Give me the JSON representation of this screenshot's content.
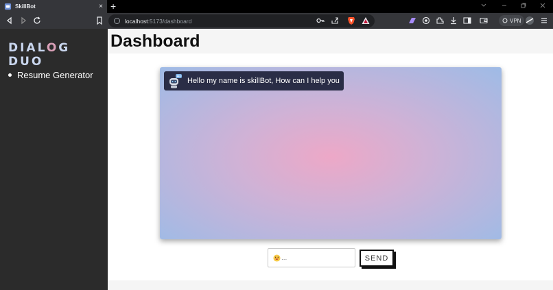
{
  "browser": {
    "tab_title": "SkillBot",
    "tab_close_glyph": "×",
    "new_tab_glyph": "+",
    "url_host": "localhost",
    "url_path": ":5173/dashboard",
    "vpn_label": "VPN"
  },
  "sidebar": {
    "logo_part1": "DIAL",
    "logo_part2": "O",
    "logo_part3": "G DUO",
    "items": [
      {
        "label": "Resume Generator"
      }
    ]
  },
  "header": {
    "title": "Dashboard"
  },
  "chat": {
    "messages": [
      {
        "sender": "bot",
        "text": "Hello my name is skillBot, How can I help you"
      }
    ],
    "input_placeholder": "...",
    "send_label": "SEND"
  },
  "colors": {
    "sidebar_bg": "#2b2b2b",
    "bubble_bg": "#2a2d46",
    "gradient_center": "#eda8c7",
    "gradient_edge": "#9ebbe6"
  }
}
